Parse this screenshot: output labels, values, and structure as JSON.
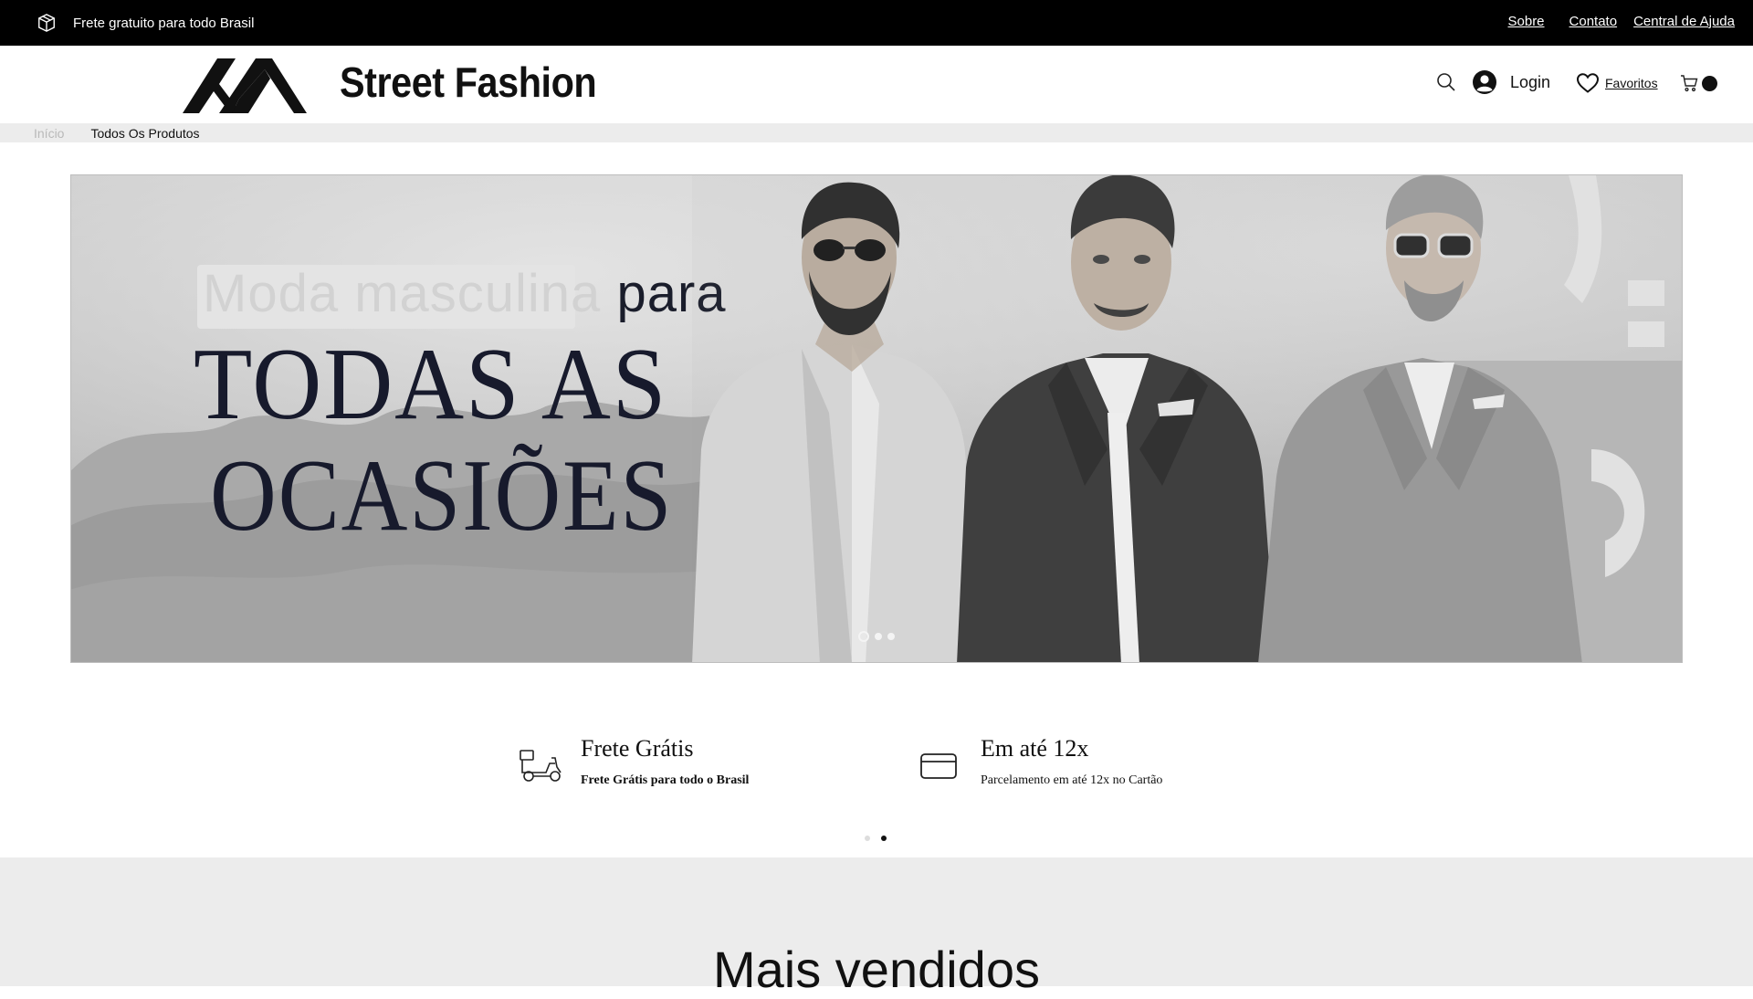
{
  "topbar": {
    "promo_text": "Frete gratuito para todo Brasil",
    "links": [
      "Sobre",
      "Contato",
      "Central de Ajuda"
    ]
  },
  "header": {
    "brand": "Street Fashion",
    "login_label": "Login",
    "favorites_label": "Favoritos",
    "icons": [
      "box-icon",
      "logo-icon",
      "search-icon",
      "user-icon",
      "heart-icon",
      "cart-icon"
    ]
  },
  "breadcrumb": {
    "items": [
      "Início",
      "Todos Os Produtos"
    ]
  },
  "hero": {
    "line1_light": "Moda masculina ",
    "line1_dark": "para",
    "line2": "TODAS AS",
    "line3": "OCASIÕES",
    "slide_count": 3,
    "active_slide": 1
  },
  "benefits": [
    {
      "icon": "delivery-scooter-icon",
      "title": "Frete Grátis",
      "subtitle": "Frete Grátis para todo o Brasil"
    },
    {
      "icon": "credit-card-icon",
      "title": "Em até 12x",
      "subtitle": "Parcelamento em até 12x no Cartão"
    }
  ],
  "benefits_pager": {
    "page_count": 2,
    "active_page": 2
  },
  "best_sellers": {
    "heading": "Mais vendidos"
  },
  "colors": {
    "topbar_bg": "#000000",
    "strip_bg": "#ececec",
    "text": "#111111"
  }
}
